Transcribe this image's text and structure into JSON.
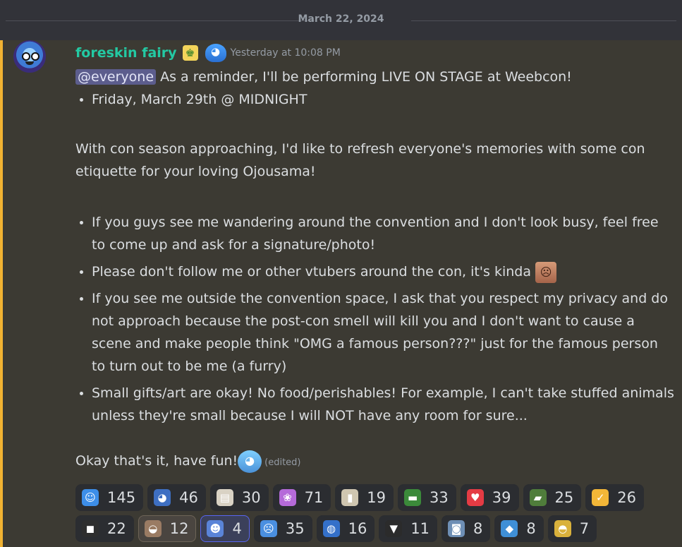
{
  "date_divider": "March 22, 2024",
  "message": {
    "author": "foreskin fairy",
    "timestamp": "Yesterday at 10:08 PM",
    "mention": "@everyone",
    "intro": "As a reminder, I'll be performing LIVE ON STAGE at Weebcon!",
    "event_bullet": "Friday, March 29th @ MIDNIGHT",
    "paragraph": "With con season approaching, I'd like to refresh everyone's memories with some con etiquette for your loving Ojousama!",
    "rules": [
      "If you guys see me wandering around the convention and I don't look busy, feel free to come up and ask for a signature/photo!",
      "Please don't follow me or other vtubers around the con, it's kinda",
      "If you see me outside the convention space, I ask that you respect my privacy and do not approach because the post-con smell will kill you and I don't want to cause a scene and make people think \"OMG a famous person???\" just for the famous person to turn out to be me (a furry)",
      "Small gifts/art are okay! No food/perishables! For example, I can't take stuffed animals unless they're small because I will NOT have any room for sure..."
    ],
    "closing": "Okay that's it, have fun!",
    "edited": "(edited)"
  },
  "reactions": [
    {
      "icon": "chibi-blue-emoji",
      "color": "#3d8ee8",
      "glyph": "☺",
      "count": "145"
    },
    {
      "icon": "shocked-face-emoji",
      "color": "#3e6fc2",
      "glyph": "◕",
      "count": "46"
    },
    {
      "icon": "paper-cup-emoji",
      "color": "#d9d2c4",
      "glyph": "▤",
      "count": "30"
    },
    {
      "icon": "pink-hair-emoji",
      "color": "#b56ad9",
      "glyph": "❀",
      "count": "71"
    },
    {
      "icon": "jar-emoji",
      "color": "#cfc6b0",
      "glyph": "▮",
      "count": "19"
    },
    {
      "icon": "pepe-emoji",
      "color": "#3b8a3a",
      "glyph": "▬",
      "count": "33"
    },
    {
      "icon": "heart-emoji",
      "color": "#e43b44",
      "glyph": "♥",
      "count": "39"
    },
    {
      "icon": "frog-reading-emoji",
      "color": "#4f7d3b",
      "glyph": "▰",
      "count": "25"
    },
    {
      "icon": "ok-hand-emoji",
      "color": "#f2b638",
      "glyph": "✓",
      "count": "26"
    },
    {
      "icon": "dark-figure-emoji",
      "color": "#2e2e2e",
      "glyph": "◼",
      "count": "22"
    },
    {
      "icon": "sleeping-emoji",
      "color": "#9a7b63",
      "glyph": "◒",
      "count": "12"
    },
    {
      "icon": "blue-hood-emoji",
      "color": "#5a84d8",
      "glyph": "☻",
      "count": "4"
    },
    {
      "icon": "chibi-crying-emoji",
      "color": "#4a8fe0",
      "glyph": "☹",
      "count": "35"
    },
    {
      "icon": "globe-hair-emoji",
      "color": "#3470c9",
      "glyph": "◍",
      "count": "16"
    },
    {
      "icon": "screaming-emoji",
      "color": "#2b2b2b",
      "glyph": "▼",
      "count": "11"
    },
    {
      "icon": "anime-boy-emoji",
      "color": "#6e8fb5",
      "glyph": "◙",
      "count": "8"
    },
    {
      "icon": "whale-emoji",
      "color": "#3f8fd6",
      "glyph": "◆",
      "count": "8"
    },
    {
      "icon": "sunglasses-emoji",
      "color": "#d9b13c",
      "glyph": "◓",
      "count": "7"
    }
  ],
  "reaction_states": {
    "selected_index": 11,
    "highlight_index": 10
  }
}
